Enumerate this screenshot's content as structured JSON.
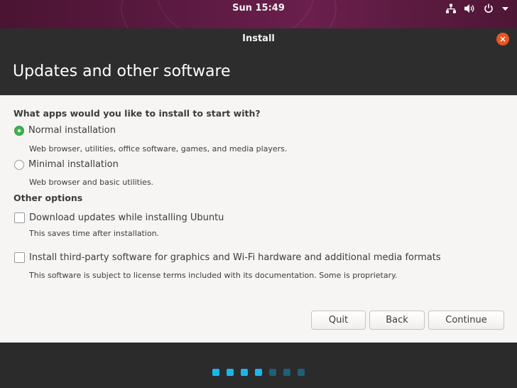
{
  "topbar": {
    "clock": "Sun 15:49",
    "tray_icons": [
      "network-icon",
      "volume-icon",
      "power-icon",
      "chevron-down-icon"
    ]
  },
  "window": {
    "title": "Install",
    "close_symbol": "×"
  },
  "header": {
    "title": "Updates and other software"
  },
  "apps_section": {
    "heading": "What apps would you like to install to start with?",
    "options": [
      {
        "label": "Normal installation",
        "description": "Web browser, utilities, office software, games, and media players.",
        "selected": true
      },
      {
        "label": "Minimal installation",
        "description": "Web browser and basic utilities.",
        "selected": false
      }
    ]
  },
  "other_options": {
    "heading": "Other options",
    "items": [
      {
        "label": "Download updates while installing Ubuntu",
        "description": "This saves time after installation.",
        "checked": false
      },
      {
        "label": "Install third-party software for graphics and Wi-Fi hardware and additional media formats",
        "description": "This software is subject to license terms included with its documentation. Some is proprietary.",
        "checked": false
      }
    ]
  },
  "buttons": {
    "quit": "Quit",
    "back": "Back",
    "continue": "Continue"
  },
  "progress": {
    "total_steps": 7,
    "completed_steps": 4,
    "active_color": "#19b6ee",
    "inactive_color": "#1d5f7a"
  },
  "colors": {
    "accent_orange": "#e95420",
    "radio_green": "#3eb34f"
  }
}
